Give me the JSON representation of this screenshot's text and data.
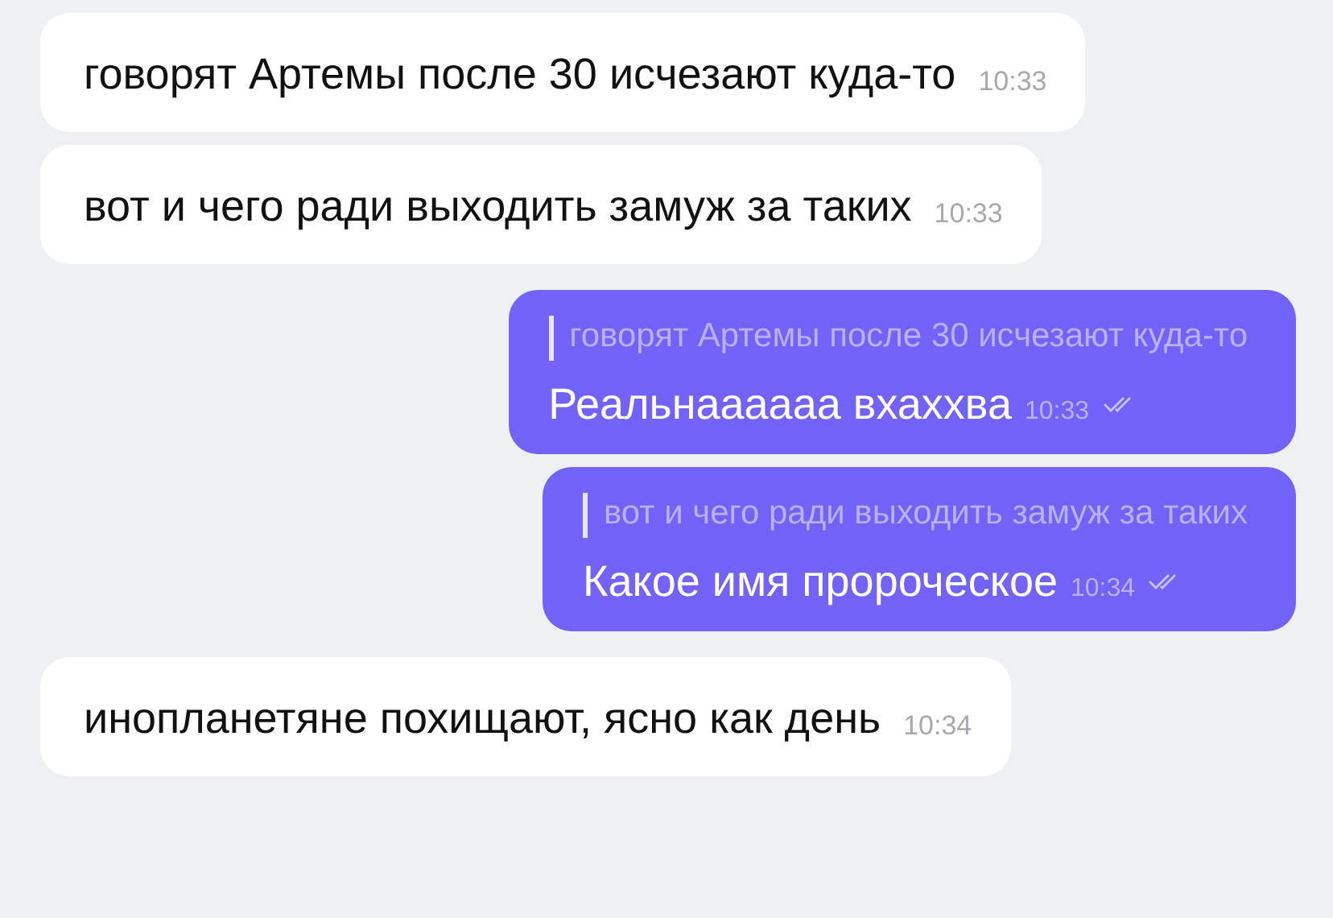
{
  "messages": [
    {
      "kind": "incoming",
      "text": "говорят Артемы после 30 исчезают куда-то",
      "time": "10:33"
    },
    {
      "kind": "incoming",
      "text": "вот и чего ради выходить замуж за таких",
      "time": "10:33"
    },
    {
      "kind": "outgoing",
      "reply": "говорят Артемы после 30 исчезают куда-то",
      "text": "Реальнаааааа вхаххва",
      "time": "10:33",
      "read": true
    },
    {
      "kind": "outgoing",
      "reply": "вот и чего ради выходить замуж за таких",
      "text": "Какое имя пророческое",
      "time": "10:34",
      "read": true
    },
    {
      "kind": "incoming",
      "text": "инопланетяне похищают, ясно как день",
      "time": "10:34"
    }
  ]
}
